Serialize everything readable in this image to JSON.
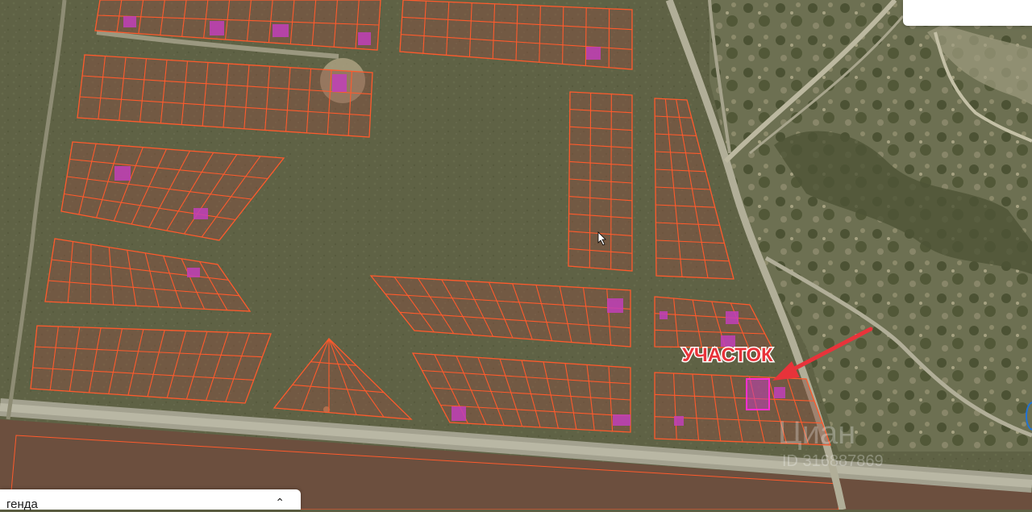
{
  "annotation": {
    "label": "УЧАСТОК"
  },
  "watermark": {
    "brand": "Циан",
    "id_text": "ID 316887869"
  },
  "legend": {
    "title": "генда",
    "chevron_icon": "chevron-up-icon"
  },
  "colors": {
    "plot_outline": "#ff5a2c",
    "plot_fill": "#8a5040",
    "built_marker": "#c13fb8",
    "arrow": "#e8333a",
    "label_fill": "#e8333a",
    "label_outline": "#ffffff"
  }
}
